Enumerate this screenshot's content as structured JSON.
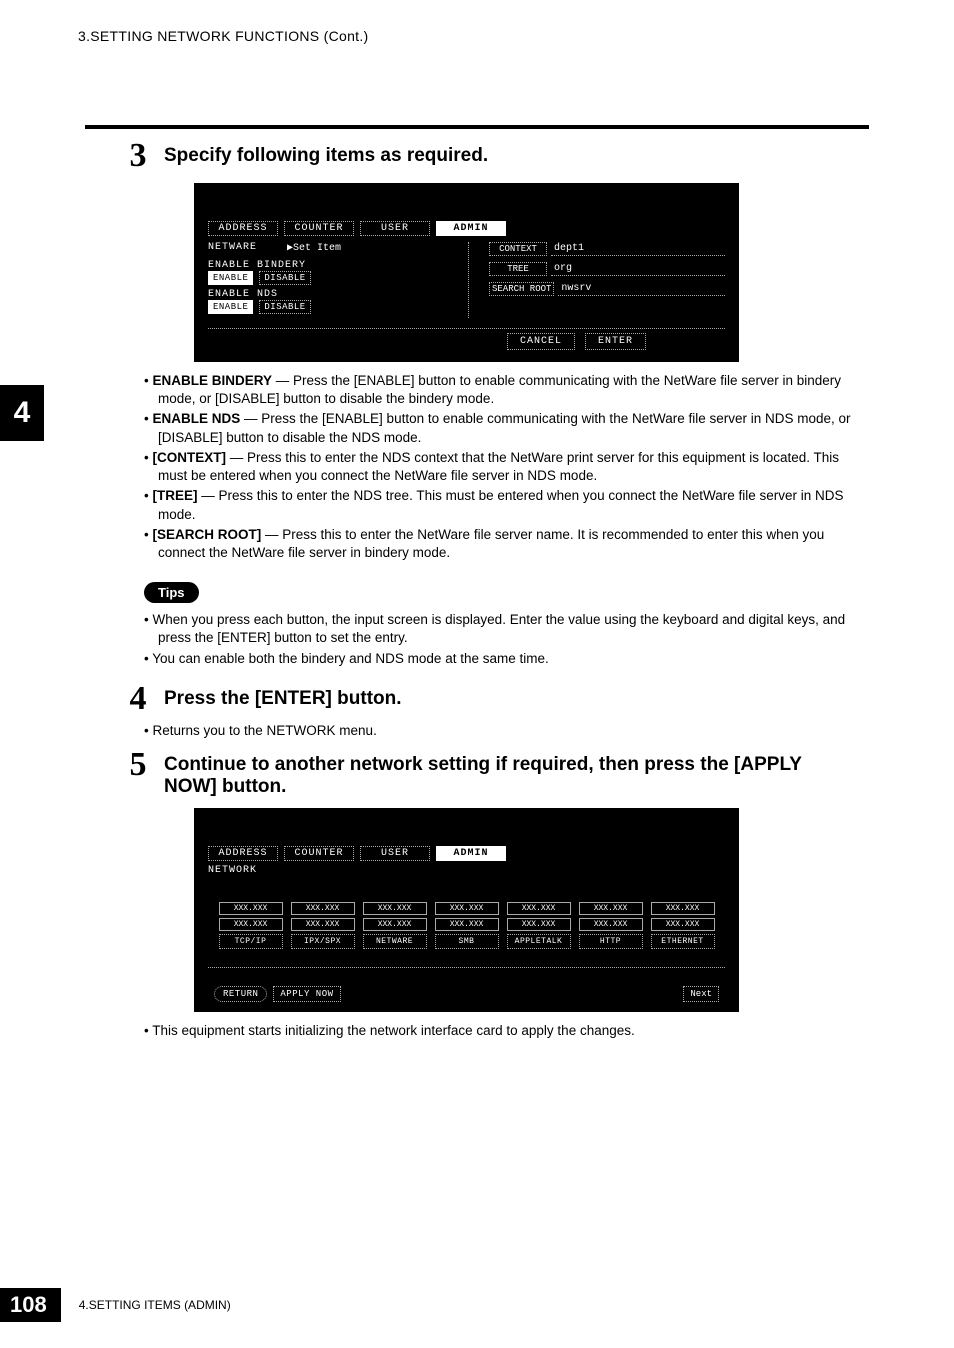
{
  "header": {
    "title": "3.SETTING NETWORK FUNCTIONS (Cont.)"
  },
  "sideTab": "4",
  "step3": {
    "num": "3",
    "title": "Specify following items as required.",
    "screen": {
      "tabs": {
        "address": "ADDRESS",
        "counter": "COUNTER",
        "user": "USER",
        "admin": "ADMIN"
      },
      "netware": "NETWARE",
      "setItem": "▶Set Item",
      "enableBindery": "ENABLE BINDERY",
      "enableNds": "ENABLE NDS",
      "enable": "ENABLE",
      "disable": "DISABLE",
      "contextLbl": "CONTEXT",
      "contextVal": "dept1",
      "treeLbl": "TREE",
      "treeVal": "org",
      "searchRootLbl": "SEARCH ROOT",
      "searchRootVal": "nwsrv",
      "cancel": "CANCEL",
      "enter": "ENTER"
    },
    "bullets": {
      "b1bold": "ENABLE BINDERY",
      "b1": " — Press the [ENABLE] button to enable communicating with the NetWare file server in bindery mode, or [DISABLE] button to disable the bindery mode.",
      "b2bold": "ENABLE NDS",
      "b2": " — Press the [ENABLE] button to enable communicating with the NetWare file server in NDS mode, or [DISABLE] button to disable the NDS mode.",
      "b3bold": "[CONTEXT]",
      "b3": " — Press this to enter the NDS context that the NetWare print server for this equipment is located.  This must be entered when you connect the NetWare file server in NDS mode.",
      "b4bold": "[TREE]",
      "b4": " — Press this to enter the NDS tree.  This must be entered when you connect the NetWare file server in NDS mode.",
      "b5bold": "[SEARCH ROOT]",
      "b5": " — Press this to enter the NetWare file server name.  It is recommended to enter this when you connect the NetWare file server in bindery mode."
    },
    "tipsLabel": "Tips",
    "tips": {
      "t1": "When you press each button, the input screen is displayed.  Enter the value using the keyboard and digital keys, and press the [ENTER] button to set the entry.",
      "t2": "You can enable both the bindery and NDS mode at the same time."
    }
  },
  "step4": {
    "num": "4",
    "title": "Press the [ENTER] button.",
    "bullet": "Returns you to the NETWORK menu."
  },
  "step5": {
    "num": "5",
    "title": "Continue to another network setting if required, then press the [APPLY NOW] button.",
    "screen": {
      "tabs": {
        "address": "ADDRESS",
        "counter": "COUNTER",
        "user": "USER",
        "admin": "ADMIN"
      },
      "network": "NETWORK",
      "xxx": "XXX.XXX",
      "cats": {
        "tcpip": "TCP/IP",
        "ipxspx": "IPX/SPX",
        "netware": "NETWARE",
        "smb": "SMB",
        "appletalk": "APPLETALK",
        "http": "HTTP",
        "ethernet": "ETHERNET"
      },
      "return": "RETURN",
      "applyNow": "APPLY NOW",
      "next": "Next"
    },
    "bullet": "This equipment starts initializing the network interface card to apply the changes."
  },
  "footer": {
    "page": "108",
    "label": "4.SETTING ITEMS (ADMIN)"
  }
}
